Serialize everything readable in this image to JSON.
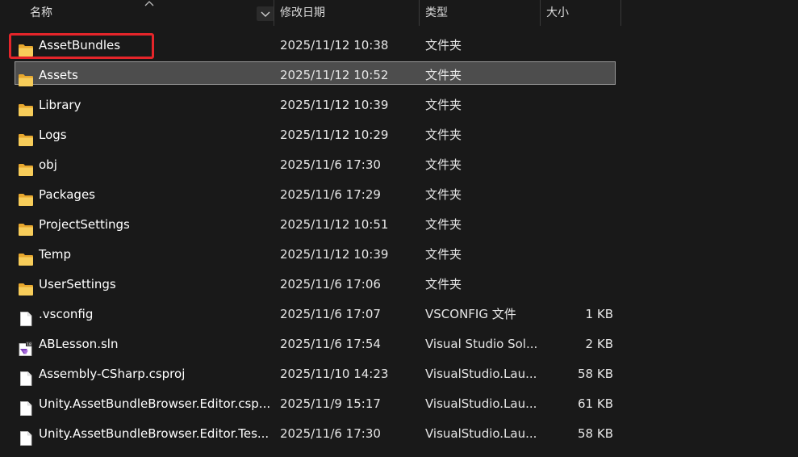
{
  "columns": {
    "name": "名称",
    "modified": "修改日期",
    "type": "类型",
    "size": "大小"
  },
  "colors": {
    "background": "#191919",
    "selection": "#4d4d4d",
    "highlight": "#e5252a",
    "folder": "#f4c451"
  },
  "files": [
    {
      "name": "AssetBundles",
      "modified": "2025/11/12 10:38",
      "type": "文件夹",
      "size": "",
      "icon": "folder-icon"
    },
    {
      "name": "Assets",
      "modified": "2025/11/12 10:52",
      "type": "文件夹",
      "size": "",
      "icon": "folder-icon"
    },
    {
      "name": "Library",
      "modified": "2025/11/12 10:39",
      "type": "文件夹",
      "size": "",
      "icon": "folder-icon"
    },
    {
      "name": "Logs",
      "modified": "2025/11/12 10:29",
      "type": "文件夹",
      "size": "",
      "icon": "folder-icon"
    },
    {
      "name": "obj",
      "modified": "2025/11/6 17:30",
      "type": "文件夹",
      "size": "",
      "icon": "folder-icon"
    },
    {
      "name": "Packages",
      "modified": "2025/11/6 17:29",
      "type": "文件夹",
      "size": "",
      "icon": "folder-icon"
    },
    {
      "name": "ProjectSettings",
      "modified": "2025/11/12 10:51",
      "type": "文件夹",
      "size": "",
      "icon": "folder-icon"
    },
    {
      "name": "Temp",
      "modified": "2025/11/12 10:39",
      "type": "文件夹",
      "size": "",
      "icon": "folder-icon"
    },
    {
      "name": "UserSettings",
      "modified": "2025/11/6 17:06",
      "type": "文件夹",
      "size": "",
      "icon": "folder-icon"
    },
    {
      "name": ".vsconfig",
      "modified": "2025/11/6 17:07",
      "type": "VSCONFIG 文件",
      "size": "1 KB",
      "icon": "file-icon"
    },
    {
      "name": "ABLesson.sln",
      "modified": "2025/11/6 17:54",
      "type": "Visual Studio Sol...",
      "size": "2 KB",
      "icon": "visual-studio-solution-icon"
    },
    {
      "name": "Assembly-CSharp.csproj",
      "modified": "2025/11/10 14:23",
      "type": "VisualStudio.Lau...",
      "size": "58 KB",
      "icon": "file-icon"
    },
    {
      "name": "Unity.AssetBundleBrowser.Editor.csp...",
      "modified": "2025/11/9 15:17",
      "type": "VisualStudio.Lau...",
      "size": "61 KB",
      "icon": "file-icon"
    },
    {
      "name": "Unity.AssetBundleBrowser.Editor.Tes...",
      "modified": "2025/11/6 17:30",
      "type": "VisualStudio.Lau...",
      "size": "58 KB",
      "icon": "file-icon"
    }
  ]
}
